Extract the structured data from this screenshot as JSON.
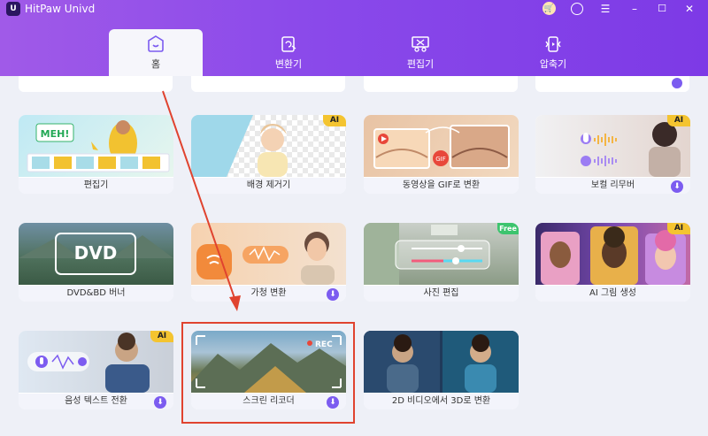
{
  "app": {
    "title": "HitPaw Univd",
    "logo": "U"
  },
  "window_controls": [
    "cart-icon",
    "user-icon",
    "menu-icon",
    "minimize-icon",
    "maximize-icon",
    "close-icon"
  ],
  "tabs": [
    {
      "label": "홈",
      "icon": "home-icon",
      "active": true
    },
    {
      "label": "변환기",
      "icon": "convert-icon",
      "active": false
    },
    {
      "label": "편집기",
      "icon": "edit-icon",
      "active": false
    },
    {
      "label": "압축기",
      "icon": "compress-icon",
      "active": false
    }
  ],
  "cards": [
    {
      "label": "편집기",
      "badge": ""
    },
    {
      "label": "배경 제거기",
      "badge": "AI"
    },
    {
      "label": "동영상을 GIF로 변환",
      "badge": ""
    },
    {
      "label": "보컬 리무버",
      "badge": "AI",
      "download": true
    },
    {
      "label": "DVD&BD 버너",
      "badge": ""
    },
    {
      "label": "가청 변환",
      "badge": "",
      "download": true
    },
    {
      "label": "사진 편집",
      "badge": "Free"
    },
    {
      "label": "AI 그림 생성",
      "badge": "AI"
    },
    {
      "label": "음성 텍스트 전환",
      "badge": "AI",
      "download": true
    },
    {
      "label": "스크린 리코더",
      "badge": "",
      "download": true
    },
    {
      "label": "2D 비디오에서 3D로 변환",
      "badge": ""
    }
  ],
  "thumb_text": {
    "mem": "MEH!",
    "gif": "GIF",
    "dvd": "DVD",
    "rec": "REC"
  },
  "colors": {
    "header_start": "#a05ae8",
    "header_end": "#7d3ae6",
    "ai_badge": "#f4c430",
    "free_badge": "#3cc46e",
    "download": "#7c5cf0",
    "highlight": "#e0432f"
  }
}
